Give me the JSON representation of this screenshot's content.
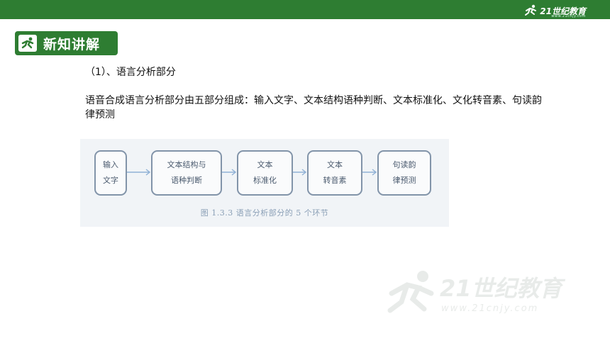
{
  "header": {
    "logo_text": "21世纪教育",
    "logo_url": "www.21cnjy.com"
  },
  "section": {
    "title": "新知讲解"
  },
  "content": {
    "heading": "（1）、语言分析部分",
    "paragraph": "语音合成语言分析部分由五部分组成：输入文字、文本结构语种判断、文本标准化、文化转音素、句读韵律预测"
  },
  "figure": {
    "boxes": [
      {
        "line1": "输入",
        "line2": "文字"
      },
      {
        "line1": "文本结构与",
        "line2": "语种判断"
      },
      {
        "line1": "文本",
        "line2": "标准化"
      },
      {
        "line1": "文本",
        "line2": "转音素"
      },
      {
        "line1": "句读韵",
        "line2": "律预测"
      }
    ],
    "caption": "图 1.3.3   语言分析部分的 5 个环节"
  },
  "watermark": {
    "text": "21世纪教育",
    "url": "www.21cnjy.com"
  },
  "colors": {
    "brand_green": "#2e7d32",
    "box_border": "#8294a9"
  }
}
